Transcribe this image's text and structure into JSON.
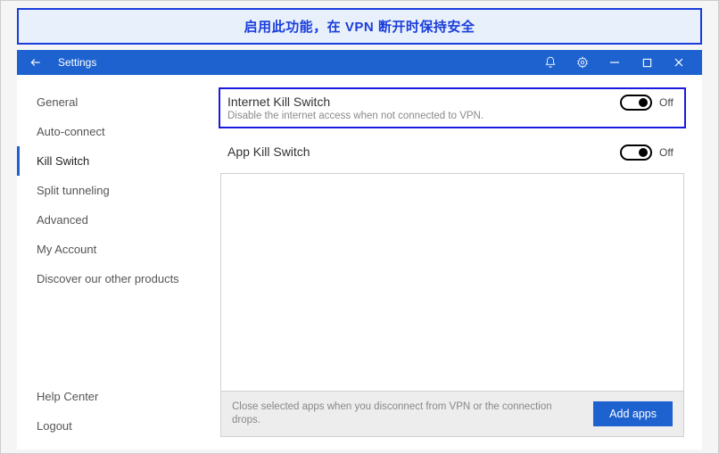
{
  "banner": {
    "text": "启用此功能，在 VPN 断开时保持安全"
  },
  "titlebar": {
    "title": "Settings"
  },
  "sidebar": {
    "items": [
      {
        "label": "General"
      },
      {
        "label": "Auto-connect"
      },
      {
        "label": "Kill Switch"
      },
      {
        "label": "Split tunneling"
      },
      {
        "label": "Advanced"
      },
      {
        "label": "My Account"
      },
      {
        "label": "Discover our other products"
      }
    ],
    "footer": [
      {
        "label": "Help Center"
      },
      {
        "label": "Logout"
      }
    ]
  },
  "main": {
    "internet_kill": {
      "title": "Internet Kill Switch",
      "desc": "Disable the internet access when not connected to VPN.",
      "state": "Off"
    },
    "app_kill": {
      "title": "App Kill Switch",
      "state": "Off"
    },
    "app_box": {
      "footer_text": "Close selected apps when you disconnect from VPN or the connection drops.",
      "add_button": "Add apps"
    }
  }
}
